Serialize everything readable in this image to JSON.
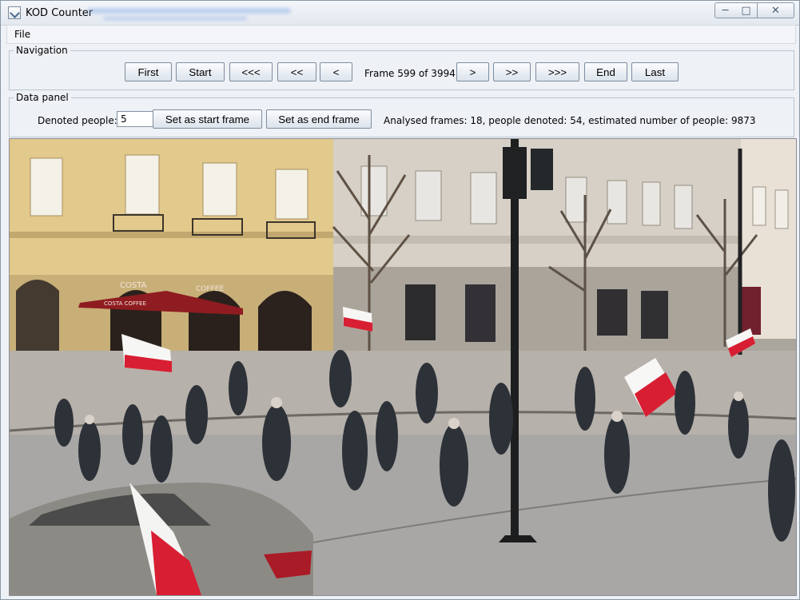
{
  "window": {
    "title": "KOD Counter"
  },
  "menu": {
    "file": "File"
  },
  "navigation": {
    "title": "Navigation",
    "buttons": [
      "First",
      "Start",
      "<<<",
      "<<",
      "<",
      ">",
      ">>",
      ">>>",
      "End",
      "Last"
    ],
    "frame_text": "Frame 599 of 3994"
  },
  "data_panel": {
    "title": "Data panel",
    "denoted_label": "Denoted people:",
    "denoted_value": "5",
    "set_start_label": "Set as start frame",
    "set_end_label": "Set as end frame",
    "status": "Analysed frames: 18, people denoted: 54, estimated number of people: 9873"
  },
  "video": {
    "storefronts": [
      "COSTA",
      "COFFEE",
      "COSTA COFFEE"
    ]
  },
  "icons": {
    "app": "app-icon",
    "minimize": "minimize-icon",
    "maximize": "maximize-icon",
    "close": "close-icon"
  },
  "colors": {
    "window_bg": "#eef1f5",
    "button_border": "#7e8d9f",
    "flag_red": "#d81e32"
  }
}
